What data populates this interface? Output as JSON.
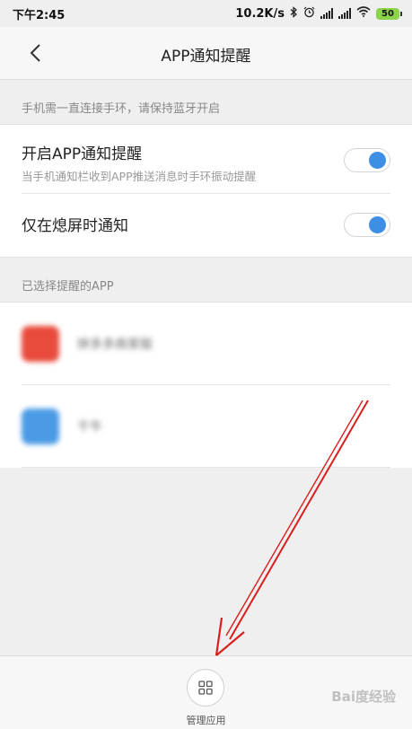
{
  "status_bar": {
    "time": "下午2:45",
    "net_speed": "10.2K/s",
    "battery": "50"
  },
  "header": {
    "title": "APP通知提醒"
  },
  "hint_top": "手机需一直连接手环，请保持蓝牙开启",
  "settings": [
    {
      "title": "开启APP通知提醒",
      "desc": "当手机通知栏收到APP推送消息时手环振动提醒",
      "enabled": true
    },
    {
      "title": "仅在熄屏时通知",
      "enabled": true
    }
  ],
  "hint_apps": "已选择提醒的APP",
  "apps": [
    {
      "name": "拼多多商家版",
      "icon_color": "#e84b3c",
      "icon": "pinduoduo-app-icon"
    },
    {
      "name": "千牛",
      "icon_color": "#4a9ae6",
      "icon": "qianniu-app-icon"
    }
  ],
  "bottom": {
    "manage_label": "管理应用",
    "icon": "grid-icon"
  },
  "watermark": "Bai度经验",
  "colors": {
    "accent": "#3d8fe6",
    "annotation_arrow": "#d91e1e"
  }
}
